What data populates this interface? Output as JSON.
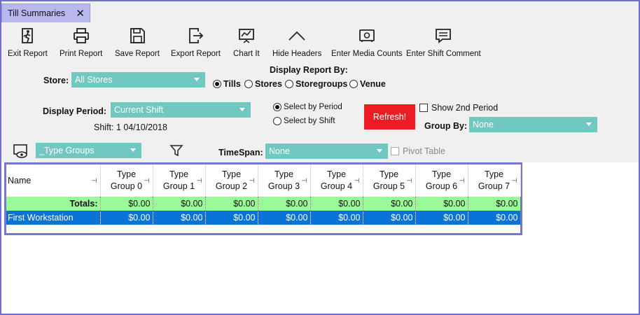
{
  "tab": {
    "title": "Till Summaries",
    "close": "✕"
  },
  "toolbar": [
    {
      "id": "exit",
      "label": "Exit Report",
      "icon": "exit-icon"
    },
    {
      "id": "print",
      "label": "Print Report",
      "icon": "printer-icon"
    },
    {
      "id": "save",
      "label": "Save Report",
      "icon": "save-icon"
    },
    {
      "id": "export",
      "label": "Export Report",
      "icon": "export-icon"
    },
    {
      "id": "chart",
      "label": "Chart It",
      "icon": "chart-icon"
    },
    {
      "id": "hide",
      "label": "Hide Headers",
      "icon": "chevron-up-icon"
    },
    {
      "id": "media",
      "label": "Enter Media Counts",
      "icon": "safe-icon"
    },
    {
      "id": "comment",
      "label": "Enter Shift Comment",
      "icon": "comment-icon"
    }
  ],
  "store": {
    "label": "Store:",
    "value": "All Stores"
  },
  "display_by": {
    "label": "Display Report By:",
    "options": [
      "Tills",
      "Stores",
      "Storegroups",
      "Venue"
    ],
    "selected": "Tills"
  },
  "period": {
    "label": "Display Period:",
    "value": "Current Shift",
    "shift_text": "Shift: 1 04/10/2018"
  },
  "select_mode": {
    "options": [
      "Select by Period",
      "Select by Shift"
    ],
    "selected": "Select by Period"
  },
  "refresh_label": "Refresh!",
  "show_second_period": "Show 2nd Period",
  "group_by": {
    "label": "Group By:",
    "value": "None"
  },
  "type_groups": {
    "value": "_Type Groups"
  },
  "timespan": {
    "label": "TimeSpan:",
    "value": "None"
  },
  "pivot_table": "Pivot Table",
  "grid": {
    "columns": [
      [
        "Name"
      ],
      [
        "Type",
        "Group 0"
      ],
      [
        "Type",
        "Group 1"
      ],
      [
        "Type",
        "Group 2"
      ],
      [
        "Type",
        "Group 3"
      ],
      [
        "Type",
        "Group 4"
      ],
      [
        "Type",
        "Group 5"
      ],
      [
        "Type",
        "Group 6"
      ],
      [
        "Type",
        "Group 7"
      ]
    ],
    "pin_glyph": "⊣",
    "totals": [
      "Totals:",
      "$0.00",
      "$0.00",
      "$0.00",
      "$0.00",
      "$0.00",
      "$0.00",
      "$0.00",
      "$0.00"
    ],
    "rows": [
      [
        "First Workstation",
        "$0.00",
        "$0.00",
        "$0.00",
        "$0.00",
        "$0.00",
        "$0.00",
        "$0.00",
        "$0.00"
      ]
    ]
  }
}
